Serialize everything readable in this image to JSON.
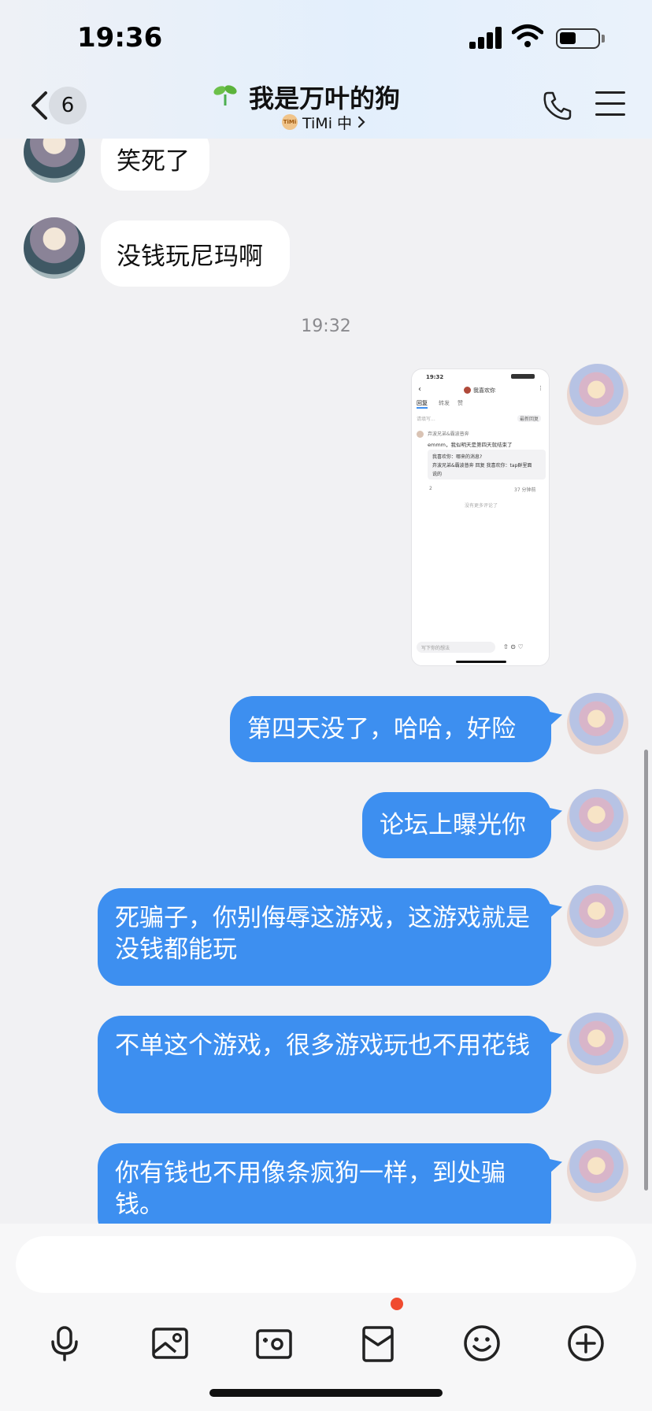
{
  "status": {
    "time": "19:36"
  },
  "header": {
    "unread_count": "6",
    "title": "我是万叶的狗",
    "subtitle": "TiMi 中",
    "timi_badge": "TiMi"
  },
  "messages": [
    {
      "side": "in",
      "text": "笑死了"
    },
    {
      "side": "in",
      "text": "没钱玩尼玛啊"
    },
    {
      "side": "time",
      "text": "19:32"
    },
    {
      "side": "out",
      "kind": "image"
    },
    {
      "side": "out",
      "text": "第四天没了，哈哈，好险"
    },
    {
      "side": "out",
      "text": "论坛上曝光你"
    },
    {
      "side": "out",
      "text": "死骗子，你别侮辱这游戏，这游戏就是没钱都能玩"
    },
    {
      "side": "out",
      "text": "不单这个游戏，很多游戏玩也不用花钱"
    },
    {
      "side": "out",
      "text": "你有钱也不用像条疯狗一样，到处骗钱。"
    }
  ],
  "thumbnail": {
    "time": "19:32",
    "name": "我喜欢你",
    "tabs": [
      "回复",
      "转发",
      "赞"
    ],
    "filter": "最新回复",
    "placeholder_top": "请填写...",
    "commenter": "弃波兄弟&霸波普奔",
    "comment": "emmm，我似明天是第四天就结束了",
    "quote_line1": "我喜欢你：哪来的消息?",
    "quote_line2": "弃波兄弟&霸波普奔 回复 我喜欢你：tap群里面",
    "quote_line3": "说的",
    "meta_left": "2",
    "meta_right": "37 分钟前",
    "no_more": "没有更多评论了",
    "input_placeholder": "写下你的想法"
  },
  "input": {
    "placeholder": ""
  },
  "toolbar": {
    "icons": [
      "microphone-icon",
      "photo-icon",
      "camera-icon",
      "red-packet-icon",
      "emoji-icon",
      "plus-icon"
    ],
    "badge_color": "#f04b2f"
  },
  "colors": {
    "outgoing_bubble": "#3d8ff0",
    "incoming_bubble": "#ffffff",
    "background": "#f1f1f3"
  }
}
